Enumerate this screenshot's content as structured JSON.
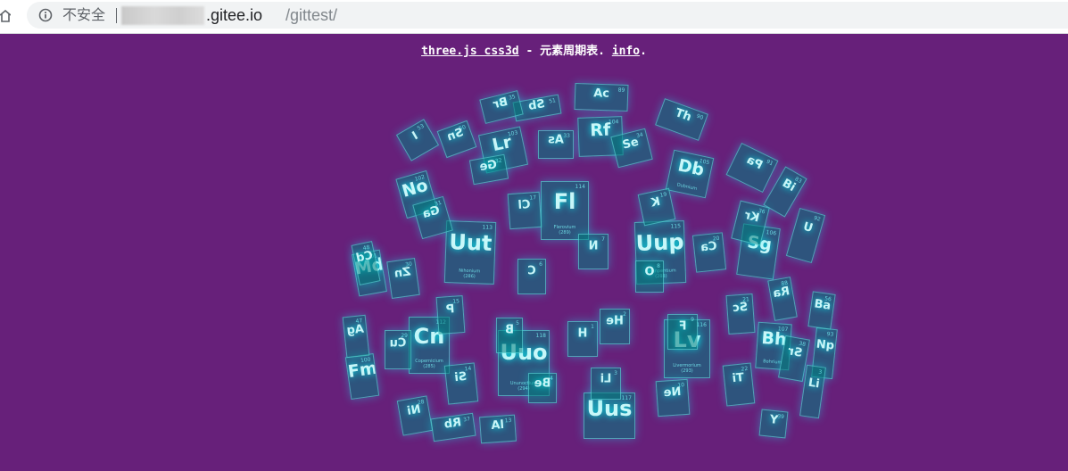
{
  "browser": {
    "security_label": "不安全",
    "url_domain": ".gitee.io",
    "url_path": "/gittest/"
  },
  "page": {
    "link_threejs": "three.js css3d",
    "dash": " - ",
    "subtitle": "元素周期表.",
    "link_info": "info",
    "trailing": "."
  },
  "colors": {
    "background": "#67207a",
    "tile_fill": "rgba(0,127,127,0.55)",
    "tile_glow": "#00ffff"
  },
  "elements": [
    {
      "symbol": "Fl",
      "number": "114",
      "name": "Flerovium",
      "mass": "(289)",
      "style": "front",
      "size": "lg",
      "box": "fl"
    },
    {
      "symbol": "Uut",
      "number": "113",
      "name": "Nihonium",
      "mass": "(286)",
      "style": "front",
      "size": "lg",
      "box": "uut"
    },
    {
      "symbol": "Uup",
      "number": "115",
      "name": "Ununpentium",
      "mass": "(288)",
      "style": "front",
      "size": "lg",
      "box": "uup"
    },
    {
      "symbol": "Uuo",
      "number": "118",
      "name": "Ununoctium",
      "mass": "(294)",
      "style": "front",
      "size": "lg",
      "box": "uuo"
    },
    {
      "symbol": "Cn",
      "number": "112",
      "name": "Copernicium",
      "mass": "(285)",
      "style": "front",
      "size": "lg",
      "box": "cn"
    },
    {
      "symbol": "Lv",
      "number": "116",
      "name": "Livermorium",
      "mass": "(293)",
      "style": "front",
      "size": "lg",
      "box": "lv"
    },
    {
      "symbol": "Uus",
      "number": "117",
      "name": "",
      "mass": "",
      "style": "front",
      "size": "lg",
      "box": "uus"
    },
    {
      "symbol": "Sg",
      "number": "106",
      "name": "",
      "mass": "",
      "style": "front",
      "size": "md",
      "box": "sg"
    },
    {
      "symbol": "Db",
      "number": "105",
      "name": "Dubnium",
      "mass": "",
      "style": "front",
      "size": "md",
      "box": "db"
    },
    {
      "symbol": "Bh",
      "number": "107",
      "name": "Bohrium",
      "mass": "",
      "style": "front",
      "size": "md",
      "box": "bh"
    },
    {
      "symbol": "Rf",
      "number": "104",
      "name": "",
      "mass": "",
      "style": "front",
      "size": "md",
      "box": "rf"
    },
    {
      "symbol": "Lr",
      "number": "103",
      "name": "",
      "mass": "",
      "style": "front",
      "size": "md",
      "box": "lr"
    },
    {
      "symbol": "No",
      "number": "102",
      "name": "",
      "mass": "",
      "style": "front",
      "size": "md",
      "box": "no"
    },
    {
      "symbol": "Md",
      "number": "101",
      "name": "",
      "mass": "",
      "style": "front",
      "size": "md",
      "box": "md"
    },
    {
      "symbol": "Fm",
      "number": "100",
      "name": "",
      "mass": "",
      "style": "front",
      "size": "md",
      "box": "fm"
    },
    {
      "symbol": "H",
      "number": "1",
      "name": "",
      "mass": "",
      "style": "front",
      "size": "sm",
      "box": "h"
    },
    {
      "symbol": "He",
      "number": "2",
      "name": "",
      "mass": "",
      "style": "mirror",
      "size": "sm",
      "box": "he"
    },
    {
      "symbol": "Li",
      "number": "3",
      "name": "",
      "mass": "",
      "style": "mirror",
      "size": "sm",
      "box": "li"
    },
    {
      "symbol": "C",
      "number": "6",
      "name": "",
      "mass": "",
      "style": "mirror",
      "size": "sm",
      "box": "c"
    },
    {
      "symbol": "N",
      "number": "7",
      "name": "",
      "mass": "",
      "style": "mirror",
      "size": "sm",
      "box": "n"
    },
    {
      "symbol": "K",
      "number": "19",
      "name": "",
      "mass": "",
      "style": "mirror",
      "size": "sm",
      "box": "k"
    },
    {
      "symbol": "Ca",
      "number": "20",
      "name": "",
      "mass": "",
      "style": "mirror",
      "size": "sm",
      "box": "ca"
    },
    {
      "symbol": "Cl",
      "number": "17",
      "name": "",
      "mass": "",
      "style": "mirror",
      "size": "sm",
      "box": "cl"
    },
    {
      "symbol": "As",
      "number": "33",
      "name": "",
      "mass": "",
      "style": "mirror",
      "size": "sm",
      "box": "as"
    },
    {
      "symbol": "Ga",
      "number": "31",
      "name": "",
      "mass": "",
      "style": "mirror",
      "size": "sm",
      "box": "ga"
    },
    {
      "symbol": "Ge",
      "number": "32",
      "name": "",
      "mass": "",
      "style": "mirror",
      "size": "sm",
      "box": "ge"
    },
    {
      "symbol": "Zn",
      "number": "30",
      "name": "",
      "mass": "",
      "style": "mirror",
      "size": "sm",
      "box": "zn"
    },
    {
      "symbol": "Cu",
      "number": "29",
      "name": "",
      "mass": "",
      "style": "mirror",
      "size": "sm",
      "box": "cu"
    },
    {
      "symbol": "Cd",
      "number": "48",
      "name": "",
      "mass": "",
      "style": "mirror",
      "size": "sm",
      "box": "cd"
    },
    {
      "symbol": "Ag",
      "number": "47",
      "name": "",
      "mass": "",
      "style": "mirror",
      "size": "sm",
      "box": "ag"
    },
    {
      "symbol": "Sc",
      "number": "21",
      "name": "",
      "mass": "",
      "style": "mirror",
      "size": "sm",
      "box": "sc"
    },
    {
      "symbol": "Ti",
      "number": "22",
      "name": "",
      "mass": "",
      "style": "mirror",
      "size": "sm",
      "box": "ti"
    },
    {
      "symbol": "Ne",
      "number": "10",
      "name": "",
      "mass": "",
      "style": "mirror",
      "size": "sm",
      "box": "ne"
    },
    {
      "symbol": "Si",
      "number": "14",
      "name": "",
      "mass": "",
      "style": "mirror",
      "size": "sm",
      "box": "si"
    },
    {
      "symbol": "P",
      "number": "15",
      "name": "",
      "mass": "",
      "style": "mirror",
      "size": "sm",
      "box": "p"
    },
    {
      "symbol": "B",
      "number": "5",
      "name": "",
      "mass": "",
      "style": "mirror",
      "size": "sm",
      "box": "b"
    },
    {
      "symbol": "Be",
      "number": "4",
      "name": "",
      "mass": "",
      "style": "mirror",
      "size": "sm",
      "box": "be"
    },
    {
      "symbol": "O",
      "number": "8",
      "name": "",
      "mass": "",
      "style": "mirror",
      "size": "sm",
      "box": "o"
    },
    {
      "symbol": "F",
      "number": "9",
      "name": "",
      "mass": "",
      "style": "mirror",
      "size": "sm",
      "box": "f"
    },
    {
      "symbol": "Ra",
      "number": "88",
      "name": "",
      "mass": "",
      "style": "mirror",
      "size": "sm",
      "box": "ra"
    },
    {
      "symbol": "Sb",
      "number": "51",
      "name": "",
      "mass": "",
      "style": "mirror",
      "size": "sm",
      "box": "sb"
    },
    {
      "symbol": "Ac",
      "number": "89",
      "name": "",
      "mass": "",
      "style": "front",
      "size": "sm",
      "box": "ac"
    },
    {
      "symbol": "Th",
      "number": "90",
      "name": "",
      "mass": "",
      "style": "front",
      "size": "sm",
      "box": "th"
    },
    {
      "symbol": "Pa",
      "number": "91",
      "name": "",
      "mass": "",
      "style": "mirror",
      "size": "sm",
      "box": "pa"
    },
    {
      "symbol": "Sr",
      "number": "38",
      "name": "",
      "mass": "",
      "style": "mirror",
      "size": "sm",
      "box": "sr"
    },
    {
      "symbol": "Np",
      "number": "93",
      "name": "",
      "mass": "",
      "style": "front",
      "size": "sm",
      "box": "np"
    },
    {
      "symbol": "U",
      "number": "92",
      "name": "",
      "mass": "",
      "style": "front",
      "size": "sm",
      "box": "u"
    },
    {
      "symbol": "Ni",
      "number": "28",
      "name": "",
      "mass": "",
      "style": "mirror",
      "size": "sm",
      "box": "ni"
    },
    {
      "symbol": "Rb",
      "number": "37",
      "name": "",
      "mass": "",
      "style": "mirror",
      "size": "sm",
      "box": "rb"
    },
    {
      "symbol": "Y",
      "number": "39",
      "name": "",
      "mass": "",
      "style": "front",
      "size": "sm",
      "box": "y"
    },
    {
      "symbol": "Li",
      "number": "3",
      "name": "",
      "mass": "",
      "style": "front",
      "size": "sm",
      "box": "li2"
    },
    {
      "symbol": "Ba",
      "number": "56",
      "name": "",
      "mass": "",
      "style": "front",
      "size": "sm",
      "box": "ba"
    },
    {
      "symbol": "Kr",
      "number": "36",
      "name": "",
      "mass": "",
      "style": "mirror",
      "size": "sm",
      "box": "kr"
    },
    {
      "symbol": "Se",
      "number": "34",
      "name": "",
      "mass": "",
      "style": "front",
      "size": "sm",
      "box": "se"
    },
    {
      "symbol": "Sn",
      "number": "50",
      "name": "",
      "mass": "",
      "style": "mirror",
      "size": "sm",
      "box": "sn"
    },
    {
      "symbol": "Br",
      "number": "35",
      "name": "",
      "mass": "",
      "style": "mirror",
      "size": "sm",
      "box": "br"
    },
    {
      "symbol": "I",
      "number": "53",
      "name": "",
      "mass": "",
      "style": "front",
      "size": "sm",
      "box": "i"
    },
    {
      "symbol": "Bi",
      "number": "83",
      "name": "",
      "mass": "",
      "style": "front",
      "size": "sm",
      "box": "bi"
    },
    {
      "symbol": "Al",
      "number": "13",
      "name": "",
      "mass": "",
      "style": "front",
      "size": "sm",
      "box": "al"
    }
  ]
}
